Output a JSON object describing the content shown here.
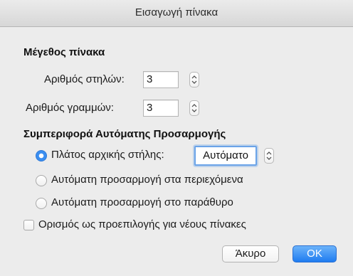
{
  "window": {
    "title": "Εισαγωγή πίνακα"
  },
  "table_size": {
    "heading": "Μέγεθος πίνακα",
    "columns": {
      "label": "Αριθμός στηλών:",
      "value": "3"
    },
    "rows": {
      "label": "Αριθμός γραμμών:",
      "value": "3"
    }
  },
  "autofit": {
    "heading": "Συμπεριφορά Αυτόματης Προσαρμογής",
    "options": [
      {
        "label": "Πλάτος αρχικής στήλης:",
        "selected": true
      },
      {
        "label": "Αυτόματη προσαρμογή στα περιεχόμενα",
        "selected": false
      },
      {
        "label": "Αυτόματη προσαρμογή στο παράθυρο",
        "selected": false
      }
    ],
    "column_width_value": "Αυτόματο"
  },
  "default_checkbox": {
    "label": "Ορισμός ως προεπιλογής για νέους πίνακες",
    "checked": false
  },
  "buttons": {
    "cancel": "Άκυρο",
    "ok": "OK"
  },
  "colors": {
    "accent": "#3b8ef0",
    "ok_button": "#1f7cf0",
    "background": "#ececec"
  },
  "icons": {
    "stepper": "stepper-icon",
    "radio": "radio-button",
    "checkbox": "checkbox"
  }
}
